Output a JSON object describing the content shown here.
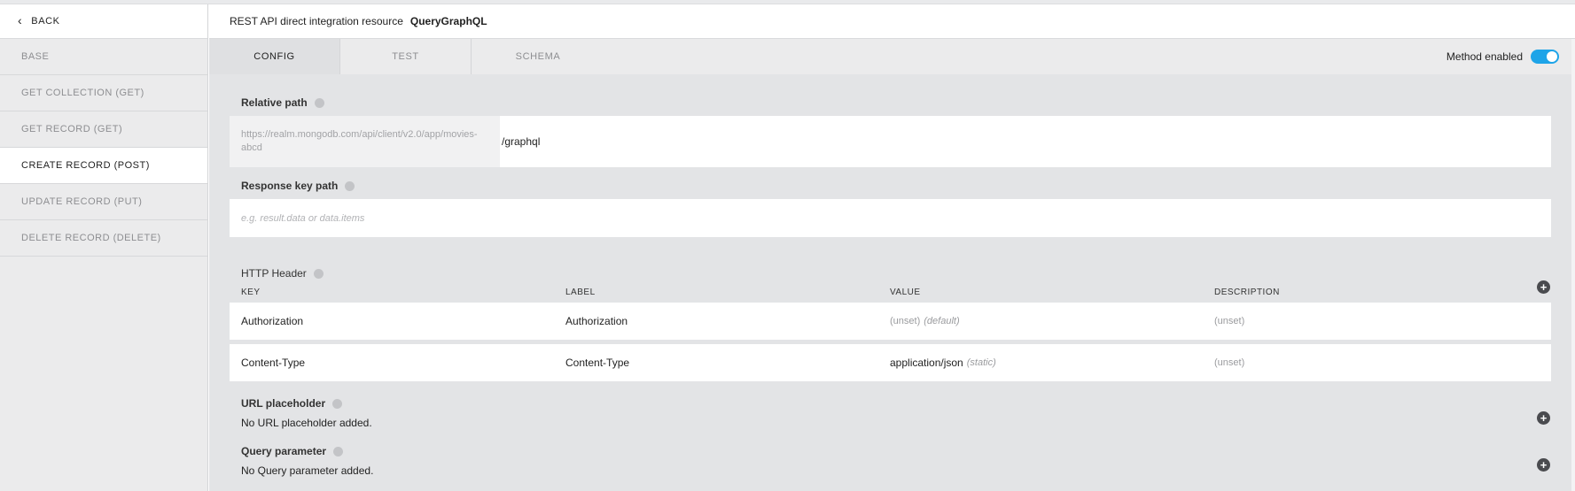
{
  "sidebar": {
    "back_label": "BACK",
    "items": [
      {
        "label": "BASE"
      },
      {
        "label": "GET COLLECTION (GET)"
      },
      {
        "label": "GET RECORD (GET)"
      },
      {
        "label": "CREATE RECORD (POST)"
      },
      {
        "label": "UPDATE RECORD (PUT)"
      },
      {
        "label": "DELETE RECORD (DELETE)"
      }
    ],
    "active_index": 3
  },
  "header": {
    "resource_type": "REST API direct integration resource",
    "resource_name": "QueryGraphQL"
  },
  "tabs": [
    {
      "label": "CONFIG"
    },
    {
      "label": "TEST"
    },
    {
      "label": "SCHEMA"
    }
  ],
  "method_toggle": {
    "label": "Method enabled",
    "enabled": true
  },
  "config": {
    "relative_path": {
      "label": "Relative path",
      "base_url": "https://realm.mongodb.com/api/client/v2.0/app/movies-abcd",
      "value": "/graphql"
    },
    "response_key_path": {
      "label": "Response key path",
      "placeholder": "e.g. result.data or data.items"
    },
    "http_header": {
      "label": "HTTP Header",
      "columns": [
        "KEY",
        "LABEL",
        "VALUE",
        "DESCRIPTION"
      ],
      "rows": [
        {
          "key": "Authorization",
          "label": "Authorization",
          "value": "(unset)",
          "value_note": "(default)",
          "description": "(unset)"
        },
        {
          "key": "Content-Type",
          "label": "Content-Type",
          "value": "application/json",
          "value_note": "(static)",
          "description": "(unset)"
        }
      ]
    },
    "url_placeholder": {
      "label": "URL placeholder",
      "empty_text": "No URL placeholder added."
    },
    "query_parameter": {
      "label": "Query parameter",
      "empty_text": "No Query parameter added."
    }
  },
  "colors": {
    "toggle_on": "#1ea4e8",
    "main_bg": "#e3e4e6",
    "sidebar_bg": "#ebebec"
  }
}
